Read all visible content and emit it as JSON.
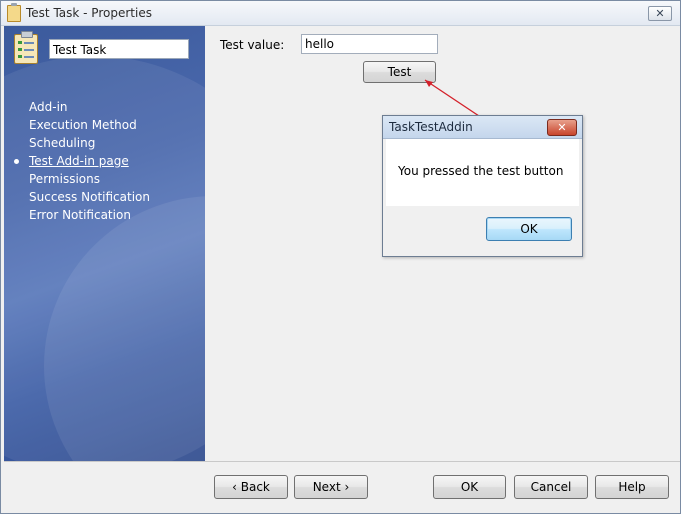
{
  "window": {
    "title": "Test Task - Properties",
    "close_glyph": "✕"
  },
  "sidebar": {
    "task_name": "Test Task",
    "items": [
      {
        "label": "Add-in",
        "active": false
      },
      {
        "label": "Execution Method",
        "active": false
      },
      {
        "label": "Scheduling",
        "active": false
      },
      {
        "label": "Test Add-in page",
        "active": true
      },
      {
        "label": "Permissions",
        "active": false
      },
      {
        "label": "Success Notification",
        "active": false
      },
      {
        "label": "Error Notification",
        "active": false
      }
    ]
  },
  "content": {
    "test_value_label": "Test value:",
    "test_value": "hello",
    "test_button": "Test"
  },
  "dialog": {
    "title": "TaskTestAddin",
    "close_glyph": "✕",
    "message": "You pressed the test button",
    "ok_label": "OK"
  },
  "footer": {
    "back_label": "‹ Back",
    "next_label": "Next ›",
    "ok_label": "OK",
    "cancel_label": "Cancel",
    "help_label": "Help"
  },
  "colors": {
    "sidebar": "#4b69ad",
    "annotation_arrow": "#d4202a"
  }
}
